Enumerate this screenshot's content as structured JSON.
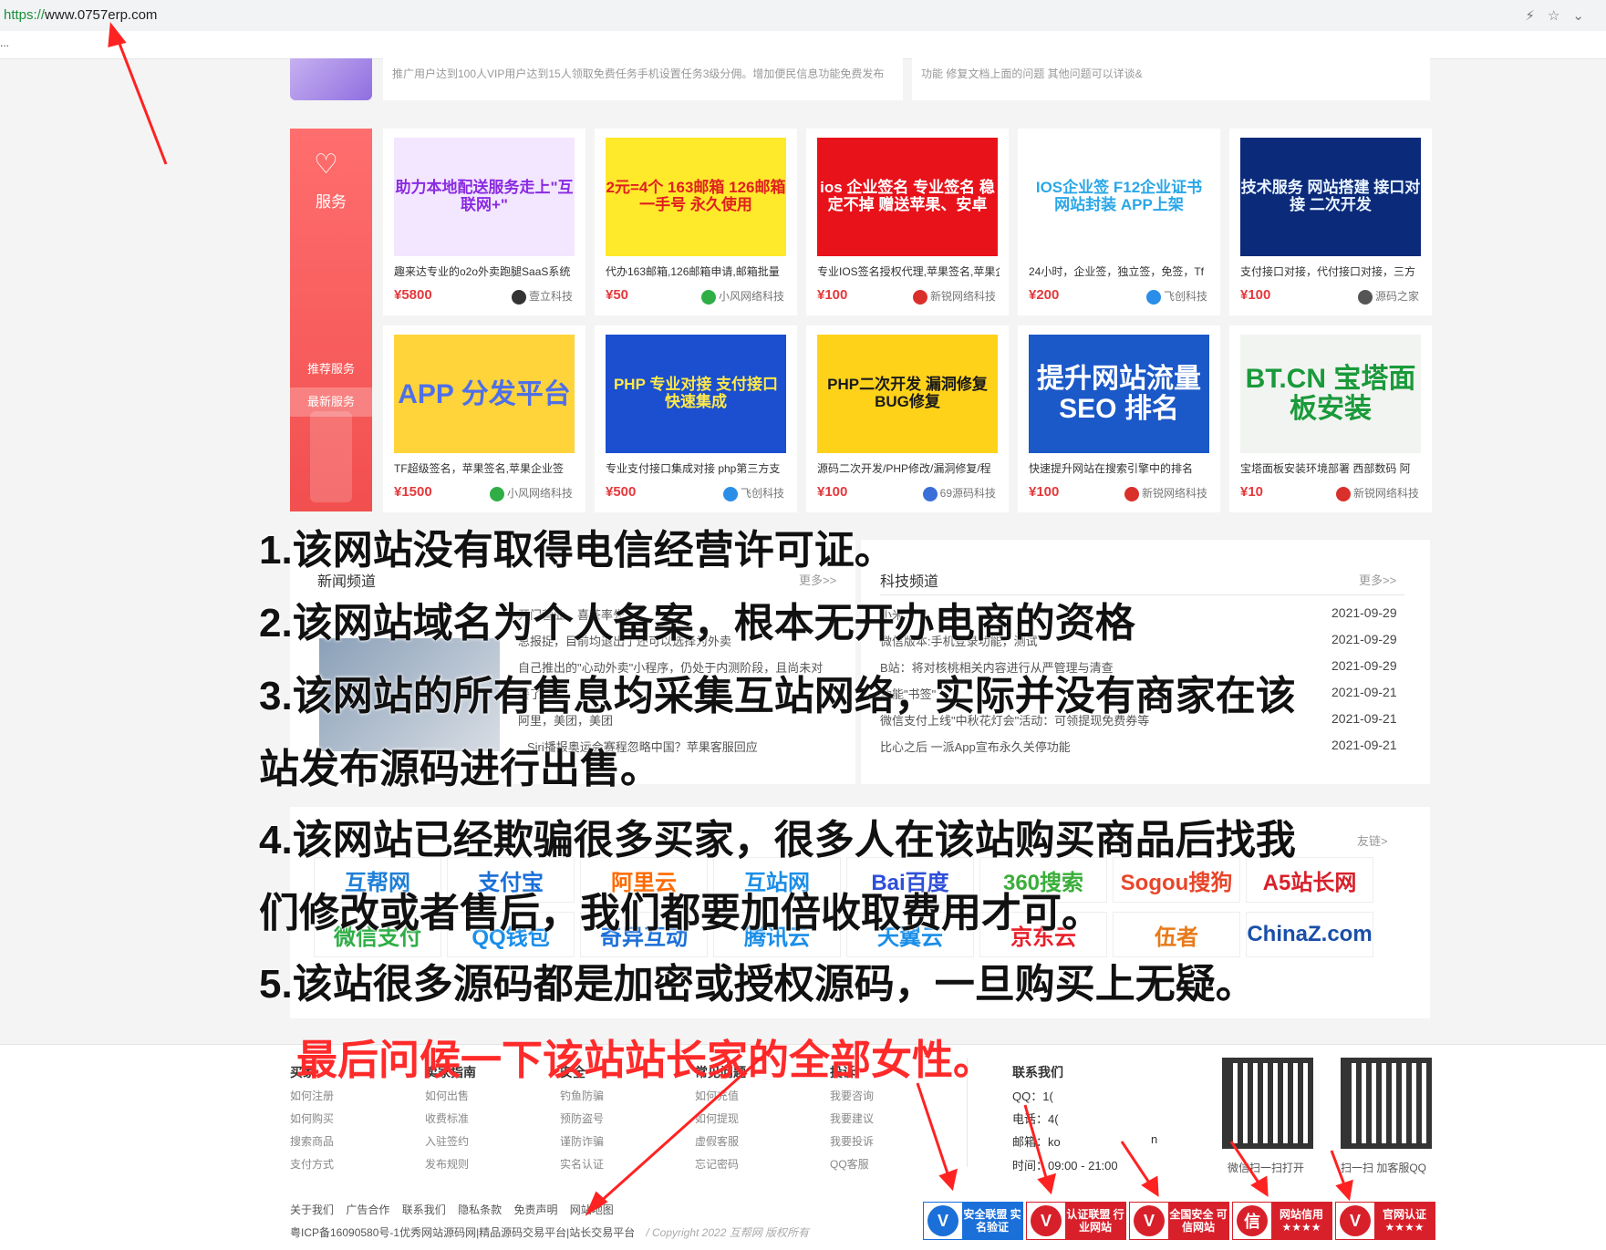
{
  "browser": {
    "url_proto": "https://",
    "url_host": "www.0757erp.com",
    "bookmark_overflow": "..."
  },
  "top_strip": {
    "left_text": "推广用户达到100人VIP用户达到15人领取免费任务手机设置任务3级分佣。增加便民信息功能免费发布",
    "right_text": "功能 修复文档上面的问题 其他问题可以详谈&"
  },
  "service": {
    "title": "服务",
    "tabs": [
      "推荐服务",
      "最新服务"
    ]
  },
  "products": [
    {
      "thumb": "助力本地配送服务走上\"互联网+\"",
      "desc": "趣来达专业的o2o外卖跑腿SaaS系统",
      "price": "¥5800",
      "shop": "壹立科技",
      "thumb_bg": "#f3e6ff",
      "thumb_color": "#8a2be2",
      "shop_color": "#333333"
    },
    {
      "thumb": "2元=4个 163邮箱 126邮箱 一手号 永久使用",
      "desc": "代办163邮箱,126邮箱申请,邮箱批量",
      "price": "¥50",
      "shop": "小风网络科技",
      "thumb_bg": "#ffe92b",
      "thumb_color": "#e02020",
      "shop_color": "#2fae46"
    },
    {
      "thumb": "ios 企业签名 专业签名 稳定不掉 赠送苹果、安卓",
      "desc": "专业IOS签名授权代理,苹果签名,苹果企",
      "price": "¥100",
      "shop": "新锐网络科技",
      "thumb_bg": "#e8121b",
      "thumb_color": "#ffffff",
      "shop_color": "#d9302b"
    },
    {
      "thumb": "IOS企业签 F12企业证书 网站封装 APP上架",
      "desc": "24小时，企业签，独立签，免签，Tf",
      "price": "¥200",
      "shop": "飞创科技",
      "thumb_bg": "#ffffff",
      "thumb_color": "#2aa7e8",
      "shop_color": "#2a8ee8"
    },
    {
      "thumb": "技术服务 网站搭建 接口对接 二次开发",
      "desc": "支付接口对接，代付接口对接，三方",
      "price": "¥100",
      "shop": "源码之家",
      "thumb_bg": "#0c2a7a",
      "thumb_color": "#e9f4ff",
      "shop_color": "#555555"
    },
    {
      "thumb": "APP 分发平台",
      "desc": "TF超级签名，苹果签名,苹果企业签",
      "price": "¥1500",
      "shop": "小风网络科技",
      "thumb_bg": "#ffd43a",
      "thumb_color": "#4f6fe8",
      "shop_color": "#2fae46"
    },
    {
      "thumb": "PHP 专业对接 支付接口 快速集成",
      "desc": "专业支付接口集成对接 php第三方支",
      "price": "¥500",
      "shop": "飞创科技",
      "thumb_bg": "#1b4fd0",
      "thumb_color": "#ffe94a",
      "shop_color": "#2a8ee8"
    },
    {
      "thumb": "PHP二次开发 漏洞修复 BUG修复",
      "desc": "源码二次开发/PHP修改/漏洞修复/程",
      "price": "¥100",
      "shop": "69源码科技",
      "thumb_bg": "#ffd21a",
      "thumb_color": "#1a1a1a",
      "shop_color": "#3a6fd8"
    },
    {
      "thumb": "提升网站流量 SEO 排名",
      "desc": "快速提升网站在搜索引擎中的排名",
      "price": "¥100",
      "shop": "新锐网络科技",
      "thumb_bg": "#1b58c8",
      "thumb_color": "#ffffff",
      "shop_color": "#d9302b"
    },
    {
      "thumb": "BT.CN 宝塔面板安装",
      "desc": "宝塔面板安装环境部署 西部数码 阿",
      "price": "¥10",
      "shop": "新锐网络科技",
      "thumb_bg": "#f2f4f2",
      "thumb_color": "#1a9a3a",
      "shop_color": "#d9302b"
    }
  ],
  "news": {
    "left_title": "新闻频道",
    "left_more": "更多>>",
    "right_title": "科技频道",
    "right_more": "更多>>",
    "left_items": [
      "开门营业，喜茶率先",
      "总报捉，目前均退出了还可以选择为外卖",
      "自己推出的\"心动外卖\"小程序，仍处于内测阶段，且尚未对",
      "餐了",
      "阿里，美团，美团",
      "Siri播报奥运会赛程忽略中国？苹果客服回应"
    ],
    "right_items": [
      {
        "text": "小米",
        "date": "2021-09-29"
      },
      {
        "text": "微信版本:手机登录功能，测试",
        "date": "2021-09-29"
      },
      {
        "text": "B站：将对核桃相关内容进行从严管理与清查",
        "date": "2021-09-29"
      },
      {
        "text": "功能\"书签\"",
        "date": "2021-09-21"
      },
      {
        "text": "微信支付上线\"中秋花灯会\"活动：可领提现免费券等",
        "date": "2021-09-21"
      },
      {
        "text": "比心之后 一派App宣布永久关停功能",
        "date": "2021-09-21"
      }
    ],
    "links_more": "友链>"
  },
  "logos": [
    {
      "text": "互帮网",
      "color": "#1e7fd8"
    },
    {
      "text": "支付宝",
      "color": "#1a6fd8"
    },
    {
      "text": "阿里云",
      "color": "#ff6a00"
    },
    {
      "text": "互站网",
      "color": "#1a8ee8"
    },
    {
      "text": "Bai百度",
      "color": "#2f4fd8"
    },
    {
      "text": "360搜索",
      "color": "#3aae3a"
    },
    {
      "text": "Sogou搜狗",
      "color": "#e8462b"
    },
    {
      "text": "A5站长网",
      "color": "#d8202b"
    },
    {
      "text": "微信支付",
      "color": "#2fae46"
    },
    {
      "text": "QQ钱包",
      "color": "#1a8ee8"
    },
    {
      "text": "奇异互动",
      "color": "#1a6fd8"
    },
    {
      "text": "腾讯云",
      "color": "#1a8ee8"
    },
    {
      "text": "天翼云",
      "color": "#1a8ee8"
    },
    {
      "text": "京东云",
      "color": "#e8202b"
    },
    {
      "text": "伍者",
      "color": "#e87a1a"
    },
    {
      "text": "ChinaZ.com",
      "color": "#1a4fa8"
    }
  ],
  "statements": [
    "1.该网站没有取得电信经营许可证。",
    "2.该网站域名为个人备案，根本无开办电商的资格",
    "3.该网站的所有售息均采集互站网络，实际并没有商家在该",
    "站发布源码进行出售。",
    "4.该网站已经欺骗很多买家，很多人在该站购买商品后找我",
    "们修改或者售后，我们都要加倍收取费用才可。",
    "5.该站很多源码都是加密或授权源码，一旦购买上无疑。"
  ],
  "closing_line": "最后问候一下该站站长家的全部女性。",
  "footer": {
    "columns": [
      {
        "title": "买家",
        "links": [
          "如何注册",
          "如何购买",
          "搜索商品",
          "支付方式"
        ]
      },
      {
        "title": "卖家指南",
        "links": [
          "如何出售",
          "收费标准",
          "入驻签约",
          "发布规则"
        ]
      },
      {
        "title": "安全",
        "links": [
          "钓鱼防骗",
          "预防盗号",
          "谨防诈骗",
          "实名认证"
        ]
      },
      {
        "title": "常见问题",
        "links": [
          "如何充值",
          "如何提现",
          "虚假客服",
          "忘记密码"
        ]
      },
      {
        "title": "投诉",
        "links": [
          "我要咨询",
          "我要建议",
          "我要投诉",
          "QQ客服"
        ]
      }
    ],
    "contact_title": "联系我们",
    "contact_lines": [
      "QQ：1(",
      "电话：4(",
      "邮箱：ko",
      "时间：09:00 - 21:00"
    ],
    "contact_suffix": "n",
    "qr_labels": [
      "微信扫一扫打开",
      "扫一扫 加客服QQ"
    ],
    "bottom_links": [
      "关于我们",
      "广告合作",
      "联系我们",
      "隐私条款",
      "免责声明",
      "网站地图"
    ],
    "icp": "粤ICP备16090580号-1优秀网站源码网|精品源码交易平台|站长交易平台",
    "copyright": "/  Copyright 2022 互帮网 版权所有",
    "badges": [
      {
        "text": "安全联盟 实名验证",
        "bg": "#1a6fd8",
        "icon": "V"
      },
      {
        "text": "认证联盟 行业网站",
        "bg": "#d8202b",
        "icon": "V"
      },
      {
        "text": "全国安全 可信网站",
        "bg": "#d8202b",
        "icon": "V"
      },
      {
        "text": "网站信用 ★★★★",
        "bg": "#d8202b",
        "icon": "信"
      },
      {
        "text": "官网认证 ★★★★",
        "bg": "#d8202b",
        "icon": "V"
      }
    ]
  },
  "colors": {
    "accent_red": "#ff2a2a",
    "price_red": "#e4393c",
    "service_red": "#f24f4f"
  }
}
